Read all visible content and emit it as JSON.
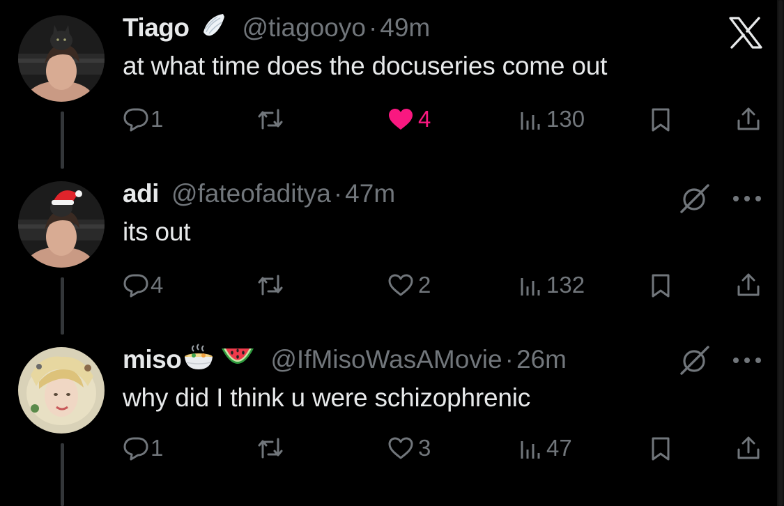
{
  "tweets": [
    {
      "display_name": "Tiago",
      "handle": "@tiagooyo",
      "separator": "·",
      "time": "49m",
      "text": "at what time does the docuseries come out",
      "replies": "1",
      "likes": "4",
      "views": "130",
      "liked": true,
      "badge_icon": "angel-wing-icon",
      "top_right_icon": "x-logo-icon"
    },
    {
      "display_name": "adi",
      "handle": "@fateofaditya",
      "separator": "·",
      "time": "47m",
      "text": "its out",
      "replies": "4",
      "likes": "2",
      "views": "132",
      "liked": false,
      "top_right_icon": "grok-icon",
      "more_icon": "more-icon"
    },
    {
      "display_name": "miso",
      "handle": "@IfMisoWasAMovie",
      "separator": "·",
      "time": "26m",
      "text": "why did I think u were schizophrenic",
      "replies": "1",
      "likes": "3",
      "views": "47",
      "liked": false,
      "badge_icons": [
        "ramen-bowl-emoji-icon",
        "watermelon-emoji-icon"
      ],
      "top_right_icon": "grok-icon",
      "more_icon": "more-icon"
    }
  ],
  "colors": {
    "background": "#000000",
    "text": "#e7e9ea",
    "secondary": "#71767b",
    "like": "#f91880",
    "thread_line": "#333639"
  }
}
